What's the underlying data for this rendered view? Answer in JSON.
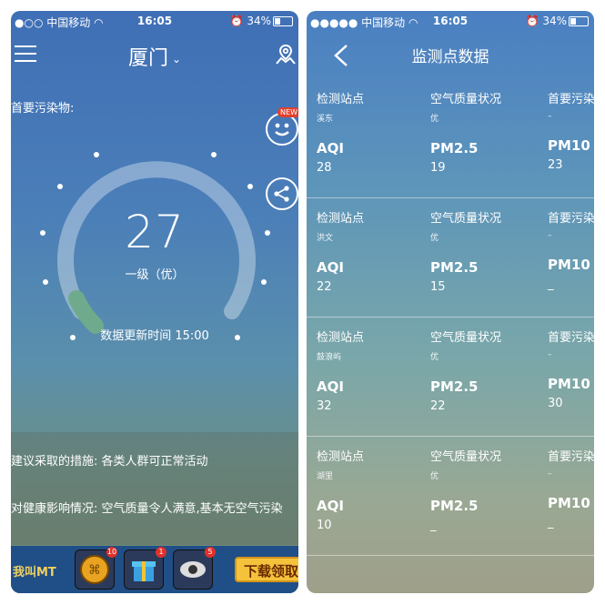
{
  "left": {
    "status": {
      "carrier": "中国移动",
      "time": "16:05",
      "battery": "34%"
    },
    "city": "厦门",
    "pollutant_label": "首要污染物:",
    "aqi": "27",
    "level": "一级（优）",
    "updated": "数据更新时间 15:00",
    "new_badge": "NEW",
    "advice": [
      "建议采取的措施: 各类人群可正常活动",
      "对健康影响情况: 空气质量令人满意,基本无空气污染"
    ],
    "ads": [
      {
        "name": "game-logo",
        "badge": ""
      },
      {
        "name": "ad-coin-icon",
        "badge": "10"
      },
      {
        "name": "ad-gift-icon",
        "badge": "1"
      },
      {
        "name": "ad-eye-icon",
        "badge": "5"
      }
    ],
    "download_label": "下载领取",
    "game_logo_text": "我叫MT"
  },
  "right": {
    "status": {
      "carrier": "中国移动",
      "time": "16:05",
      "battery": "34%"
    },
    "title": "监测点数据",
    "stations": [
      {
        "station_label": "检测站点",
        "name": "溪东",
        "quality_label": "空气质量状况",
        "quality": "优",
        "primary_label": "首要污染",
        "primary": "–",
        "aqi_label": "AQI",
        "aqi": "28",
        "pm25_label": "PM2.5",
        "pm25": "19",
        "pm10_label": "PM10",
        "pm10": "23"
      },
      {
        "station_label": "检测站点",
        "name": "洪文",
        "quality_label": "空气质量状况",
        "quality": "优",
        "primary_label": "首要污染",
        "primary": "–",
        "aqi_label": "AQI",
        "aqi": "22",
        "pm25_label": "PM2.5",
        "pm25": "15",
        "pm10_label": "PM10",
        "pm10": "_"
      },
      {
        "station_label": "检测站点",
        "name": "鼓浪屿",
        "quality_label": "空气质量状况",
        "quality": "优",
        "primary_label": "首要污染",
        "primary": "–",
        "aqi_label": "AQI",
        "aqi": "32",
        "pm25_label": "PM2.5",
        "pm25": "22",
        "pm10_label": "PM10",
        "pm10": "30"
      },
      {
        "station_label": "检测站点",
        "name": "湖里",
        "quality_label": "空气质量状况",
        "quality": "优",
        "primary_label": "首要污染",
        "primary": "–",
        "aqi_label": "AQI",
        "aqi": "10",
        "pm25_label": "PM2.5",
        "pm25": "_",
        "pm10_label": "PM10",
        "pm10": "_"
      }
    ]
  }
}
